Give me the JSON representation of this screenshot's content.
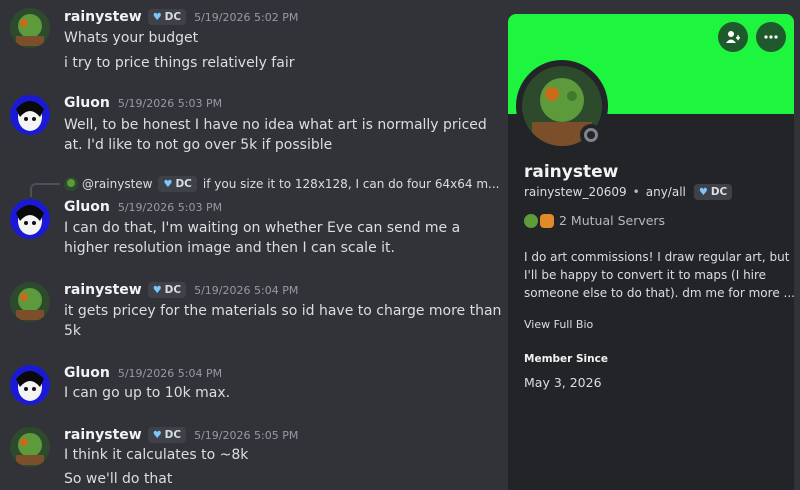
{
  "users": {
    "rainystew": {
      "name": "rainystew",
      "badge": "DC"
    },
    "gluon": {
      "name": "Gluon"
    }
  },
  "messages": [
    {
      "author": "rainystew",
      "badge": "DC",
      "time": "5/19/2026 5:02 PM",
      "lines": [
        "Whats your budget",
        "i try to price things relatively fair"
      ]
    },
    {
      "author": "Gluon",
      "time": "5/19/2026 5:03 PM",
      "lines": [
        "Well, to be honest I have no idea what art is normally priced",
        "at. I'd like to not go over 5k if possible"
      ]
    },
    {
      "author": "Gluon",
      "time": "5/19/2026 5:03 PM",
      "lines": [
        "I can do that, I'm waiting on whether Eve can send me a",
        "higher resolution image and then I can scale it."
      ],
      "reply": {
        "user": "@rainystew",
        "badge": "DC",
        "text": "if you size it to 128x128, I can do four 64x64 m..."
      }
    },
    {
      "author": "rainystew",
      "badge": "DC",
      "time": "5/19/2026 5:04 PM",
      "lines": [
        "it gets pricey for the materials so id have to charge more than",
        "5k"
      ]
    },
    {
      "author": "Gluon",
      "time": "5/19/2026 5:04 PM",
      "lines": [
        "I can go up to 10k max."
      ]
    },
    {
      "author": "rainystew",
      "badge": "DC",
      "time": "5/19/2026 5:05 PM",
      "lines": [
        "I think it calculates to ~8k",
        "So we'll do that"
      ]
    }
  ],
  "profile": {
    "banner_color": "#1ef53e",
    "display_name": "rainystew",
    "username": "rainystew_20609",
    "pronouns": "any/all",
    "badge": "DC",
    "mutual_servers": "2 Mutual Servers",
    "bio_lines": [
      "I do art commissions! I draw regular art, but",
      "I'll be happy to convert it to maps (I hire",
      "someone else to do that). dm me for more ..."
    ],
    "view_full_bio": "View Full Bio",
    "member_since_label": "Member Since",
    "member_since": "May 3, 2026",
    "add_friend_icon": "add-friend-icon",
    "more_icon": "more-options-icon"
  }
}
